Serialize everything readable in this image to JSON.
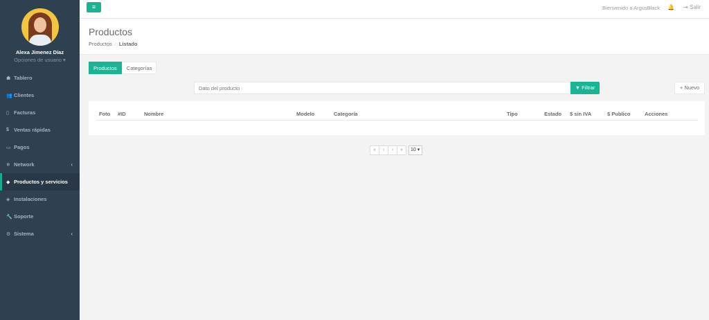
{
  "profile": {
    "name": "Alexa Jimenez Díaz",
    "options": "Opciones de usuario ▾"
  },
  "nav": [
    {
      "icon": "dashboard-icon",
      "glyph": "☗",
      "label": "Tablero",
      "chev": ""
    },
    {
      "icon": "users-icon",
      "glyph": "👥",
      "label": "Clientes",
      "chev": ""
    },
    {
      "icon": "file-icon",
      "glyph": "▯",
      "label": "Facturas",
      "chev": ""
    },
    {
      "icon": "dollar-icon",
      "glyph": "$",
      "label": "Ventas rápidas",
      "chev": ""
    },
    {
      "icon": "money-icon",
      "glyph": "▭",
      "label": "Pagos",
      "chev": ""
    },
    {
      "icon": "network-icon",
      "glyph": "❄",
      "label": "Network",
      "chev": "‹"
    },
    {
      "icon": "tag-icon",
      "glyph": "◆",
      "label": "Productos y servicios",
      "chev": ""
    },
    {
      "icon": "tags-icon",
      "glyph": "◈",
      "label": "Instalaciones",
      "chev": ""
    },
    {
      "icon": "wrench-icon",
      "glyph": "🔧",
      "label": "Soporte",
      "chev": ""
    },
    {
      "icon": "cogs-icon",
      "glyph": "⚙",
      "label": "Sistema",
      "chev": "‹"
    }
  ],
  "topbar": {
    "menu_glyph": "≡",
    "welcome": "Bienvenido a ArgusBlack",
    "bell_glyph": "🔔",
    "logout": "⇥  Salir"
  },
  "header": {
    "title": "Productos",
    "breadcrumb_root": "Productos",
    "breadcrumb_current": "Listado"
  },
  "tabs": [
    "Productos",
    "Categorías"
  ],
  "search": {
    "placeholder": "Dato del producto"
  },
  "filter_label": "Filtrar",
  "new_label": "Nuevo",
  "table": {
    "columns": [
      "Foto",
      "#ID",
      "Nombre",
      "Modelo",
      "Categoría",
      "Tipo",
      "Estado",
      "$ sin IVA",
      "$ Publico",
      "Acciones"
    ]
  },
  "pager": {
    "first": "«",
    "prev": "‹",
    "next": "›",
    "last": "»",
    "size": "10 ▾"
  },
  "colors": {
    "accent": "#1ab394",
    "sidebar": "#2f4050"
  }
}
